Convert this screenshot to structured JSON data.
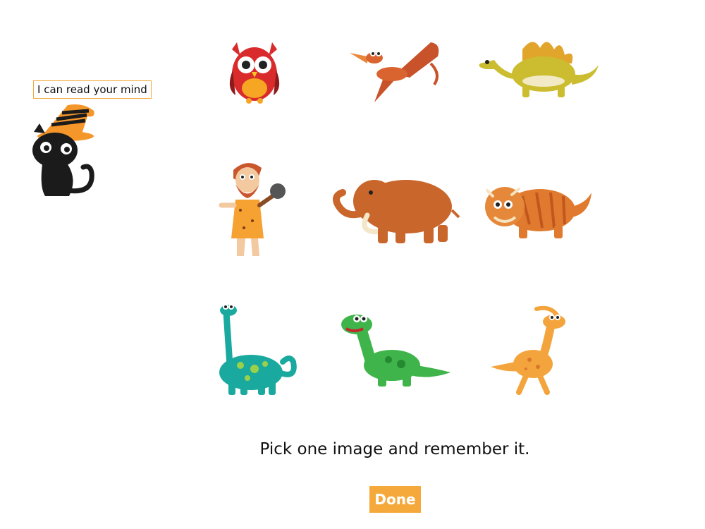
{
  "header": {
    "mind_text": "I can read your mind"
  },
  "grid": {
    "items": [
      {
        "name": "owl"
      },
      {
        "name": "pterodactyl"
      },
      {
        "name": "stegosaurus"
      },
      {
        "name": "caveman"
      },
      {
        "name": "mammoth"
      },
      {
        "name": "triceratops"
      },
      {
        "name": "brachiosaurus"
      },
      {
        "name": "green-dinosaur"
      },
      {
        "name": "parasaurolophus"
      }
    ]
  },
  "footer": {
    "instruction": "Pick one image and remember it.",
    "done_label": "Done"
  },
  "colors": {
    "accent": "#f5a93a",
    "label_border": "#f2a93b"
  }
}
